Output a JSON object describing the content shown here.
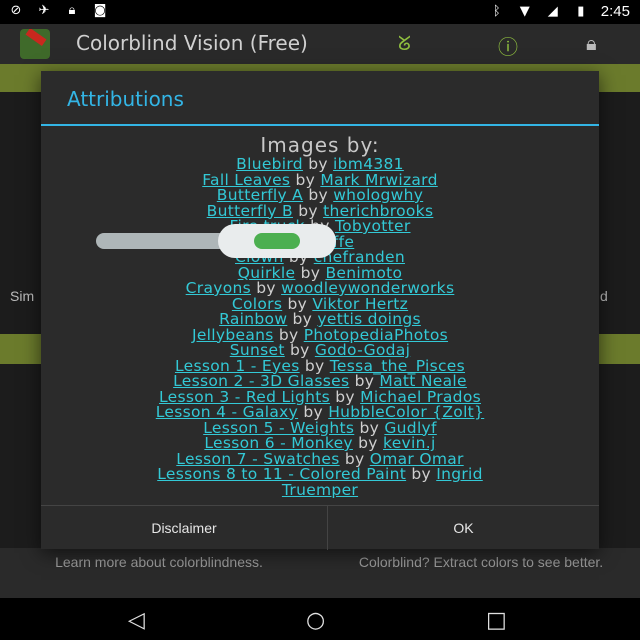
{
  "status": {
    "time": "2:45",
    "icons": [
      "sim-icon",
      "satellite-icon",
      "lock-icon",
      "android-icon"
    ],
    "right_icons": [
      "bluetooth-icon",
      "wifi-icon",
      "signal-icon",
      "battery-icon"
    ]
  },
  "app": {
    "title": "Colorblind Vision (Free)",
    "actions": [
      "g-icon",
      "info-icon",
      "lock-icon"
    ]
  },
  "background": {
    "left_fragment": "Sim",
    "right_fragment": "d",
    "cards": [
      {
        "text": "Learn more about colorblindness."
      },
      {
        "text": "Colorblind? Extract colors to see better."
      }
    ]
  },
  "dialog": {
    "title": "Attributions",
    "heading": "Images by:",
    "attributions": [
      {
        "item": "Bluebird",
        "by": "by",
        "author": "ibm4381"
      },
      {
        "item": "Fall Leaves",
        "by": "by",
        "author": "Mark Mrwizard"
      },
      {
        "item": "Butterfly A",
        "by": "by",
        "author": "whologwhy"
      },
      {
        "item": "Butterfly B",
        "by": "by",
        "author": "therichbrooks"
      },
      {
        "item": "Fire truck",
        "by": "by",
        "author": "Tobyotter"
      },
      {
        "item": "",
        "by": "",
        "author": "nchcliffe"
      },
      {
        "item": "Clown",
        "by": "by",
        "author": "chefranden"
      },
      {
        "item": "Quirkle",
        "by": "by",
        "author": "Benimoto"
      },
      {
        "item": "Crayons",
        "by": "by",
        "author": "woodleywonderworks"
      },
      {
        "item": "Colors",
        "by": "by",
        "author": "Viktor Hertz"
      },
      {
        "item": "Rainbow",
        "by": "by",
        "author": "yettis doings"
      },
      {
        "item": "Jellybeans",
        "by": "by",
        "author": "PhotopediaPhotos"
      },
      {
        "item": "Sunset",
        "by": "by",
        "author": "Godo-Godaj"
      },
      {
        "item": "Lesson 1 - Eyes",
        "by": "by",
        "author": "Tessa_the_Pisces"
      },
      {
        "item": "Lesson 2 - 3D Glasses",
        "by": "by",
        "author": "Matt Neale"
      },
      {
        "item": "Lesson 3 - Red Lights",
        "by": "by",
        "author": "Michael Prados"
      },
      {
        "item": "Lesson 4 - Galaxy",
        "by": "by",
        "author": "HubbleColor {Zolt}"
      },
      {
        "item": "Lesson 5 - Weights",
        "by": "by",
        "author": "Gudlyf"
      },
      {
        "item": "Lesson 6 - Monkey",
        "by": "by",
        "author": "kevin.j"
      },
      {
        "item": "Lesson 7 - Swatches",
        "by": "by",
        "author": "Omar Omar"
      },
      {
        "item": "Lessons 8 to 11 - Colored Paint",
        "by": "by",
        "author": "Ingrid"
      }
    ],
    "last_line": "Truemper",
    "buttons": {
      "disclaimer": "Disclaimer",
      "ok": "OK"
    }
  },
  "toggle": {
    "state": "on"
  },
  "colors": {
    "accent": "#33b5e5",
    "link": "#33c9d6",
    "toggle_on": "#4caf50"
  }
}
